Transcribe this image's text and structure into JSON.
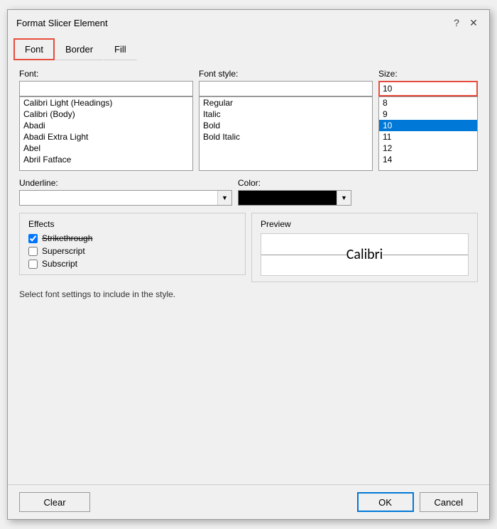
{
  "dialog": {
    "title": "Format Slicer Element",
    "help_icon": "?",
    "close_icon": "✕"
  },
  "tabs": [
    {
      "id": "font",
      "label": "Font",
      "active": true
    },
    {
      "id": "border",
      "label": "Border",
      "active": false
    },
    {
      "id": "fill",
      "label": "Fill",
      "active": false
    }
  ],
  "font_tab": {
    "font_label": "Font:",
    "font_style_label": "Font style:",
    "size_label": "Size:",
    "size_value": "10",
    "font_list": [
      {
        "name": "Calibri Light (Headings)",
        "selected": false
      },
      {
        "name": "Calibri (Body)",
        "selected": false
      },
      {
        "name": "Abadi",
        "selected": false
      },
      {
        "name": "Abadi Extra Light",
        "selected": false
      },
      {
        "name": "Abel",
        "selected": false
      },
      {
        "name": "Abril Fatface",
        "selected": false
      }
    ],
    "style_list": [
      {
        "name": "Regular",
        "selected": false
      },
      {
        "name": "Italic",
        "selected": false
      },
      {
        "name": "Bold",
        "selected": false
      },
      {
        "name": "Bold Italic",
        "selected": false
      }
    ],
    "size_list": [
      {
        "value": "8",
        "selected": false
      },
      {
        "value": "9",
        "selected": false
      },
      {
        "value": "10",
        "selected": true
      },
      {
        "value": "11",
        "selected": false
      },
      {
        "value": "12",
        "selected": false
      },
      {
        "value": "14",
        "selected": false
      }
    ],
    "underline_label": "Underline:",
    "color_label": "Color:",
    "effects_title": "Effects",
    "strikethrough_label": "Strikethrough",
    "superscript_label": "Superscript",
    "subscript_label": "Subscript",
    "preview_title": "Preview",
    "preview_text": "Calibri",
    "hint_text": "Select font settings to include in the style.",
    "clear_label": "Clear",
    "ok_label": "OK",
    "cancel_label": "Cancel"
  }
}
